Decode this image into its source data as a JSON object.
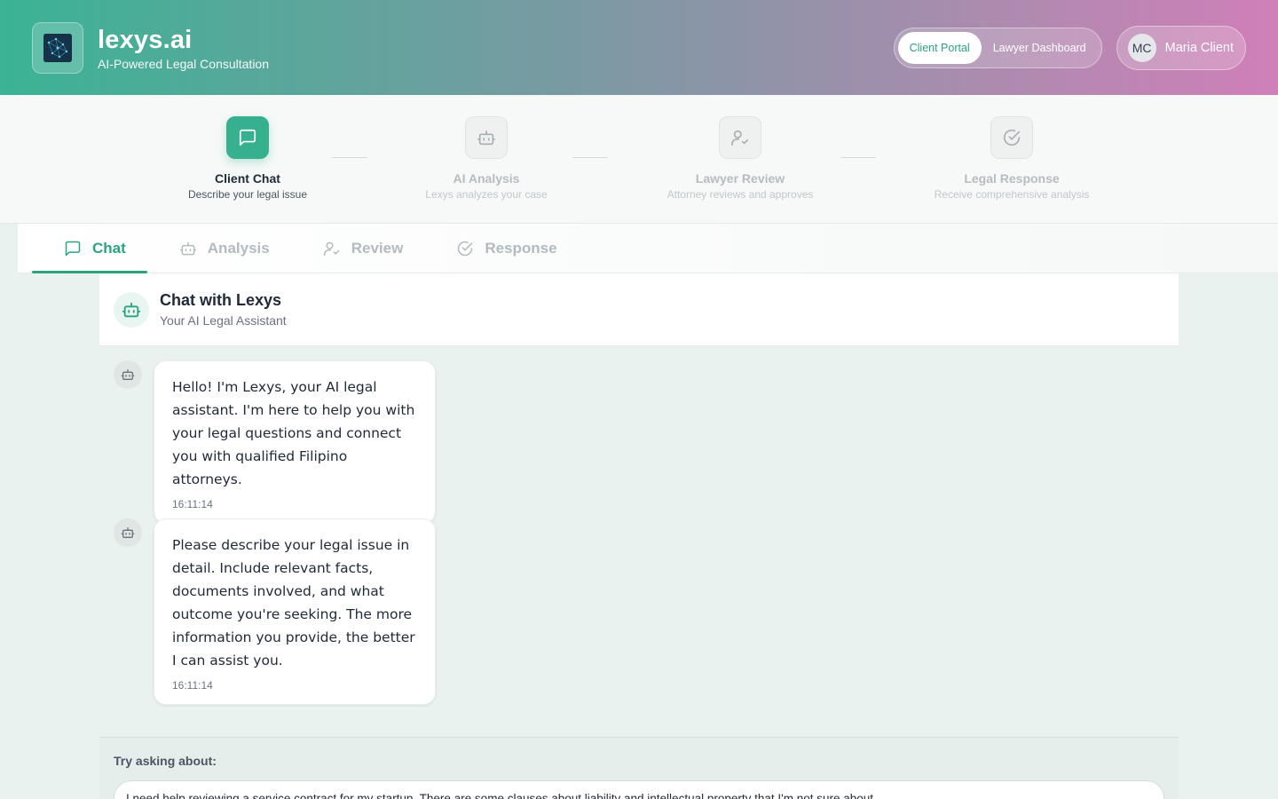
{
  "header": {
    "brand_title": "lexys.ai",
    "brand_subtitle": "AI-Powered Legal Consultation",
    "portal_toggle": {
      "client_label": "Client Portal",
      "lawyer_label": "Lawyer Dashboard",
      "active": "client"
    },
    "user": {
      "initials": "MC",
      "name": "Maria Client"
    }
  },
  "stepper": {
    "steps": [
      {
        "title": "Client Chat",
        "desc": "Describe your legal issue",
        "icon": "message-square-icon",
        "active": true
      },
      {
        "title": "AI Analysis",
        "desc": "Lexys analyzes your case",
        "icon": "bot-icon",
        "active": false
      },
      {
        "title": "Lawyer Review",
        "desc": "Attorney reviews and approves",
        "icon": "user-check-icon",
        "active": false
      },
      {
        "title": "Legal Response",
        "desc": "Receive comprehensive analysis",
        "icon": "check-circle-icon",
        "active": false
      }
    ]
  },
  "tabs": [
    {
      "label": "Chat",
      "icon": "message-square-icon",
      "active": true
    },
    {
      "label": "Analysis",
      "icon": "bot-icon",
      "active": false
    },
    {
      "label": "Review",
      "icon": "user-check-icon",
      "active": false
    },
    {
      "label": "Response",
      "icon": "check-circle-icon",
      "active": false
    }
  ],
  "chat": {
    "title": "Chat with Lexys",
    "subtitle": "Your AI Legal Assistant",
    "messages": [
      {
        "sender": "bot",
        "text": "Hello! I'm Lexys, your AI legal assistant. I'm here to help you with your legal questions and connect you with qualified Filipino attorneys.",
        "time": "16:11:14"
      },
      {
        "sender": "bot",
        "text": "Please describe your legal issue in detail. Include relevant facts, documents involved, and what outcome you're seeking. The more information you provide, the better I can assist you.",
        "time": "16:11:14"
      }
    ]
  },
  "suggestions": {
    "label": "Try asking about:",
    "items": [
      "I need help reviewing a service contract for my startup. There are some clauses about liability and intellectual property that I'm not sure about."
    ]
  },
  "colors": {
    "accent": "#2aa383",
    "header_gradient_start": "#3bb394",
    "header_gradient_end": "#d07fb8"
  }
}
